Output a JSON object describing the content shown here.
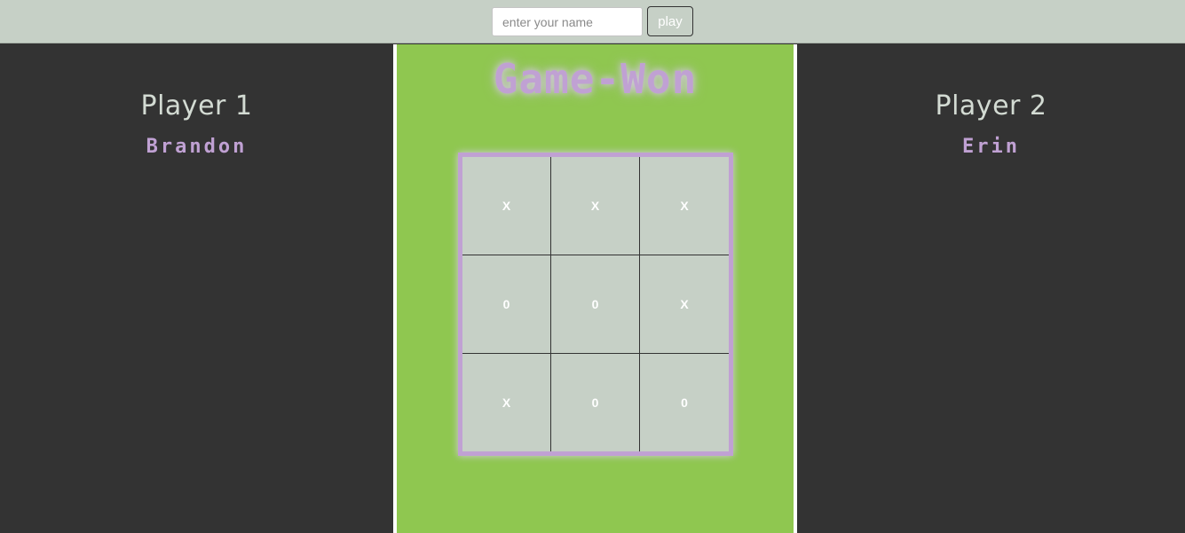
{
  "header": {
    "name_input": {
      "value": "",
      "placeholder": "enter your name"
    },
    "play_label": "play"
  },
  "player1": {
    "heading": "Player 1",
    "name": "Brandon"
  },
  "player2": {
    "heading": "Player 2",
    "name": "Erin"
  },
  "game": {
    "status": "Game-Won",
    "board": [
      [
        "X",
        "X",
        "X"
      ],
      [
        "0",
        "0",
        "X"
      ],
      [
        "X",
        "0",
        "0"
      ]
    ]
  },
  "colors": {
    "topbar": "#c6d0c6",
    "side_panel": "#333333",
    "center_panel": "#8fc750",
    "accent_purple": "#c0a1d3",
    "cell_background": "#c6d0c6"
  }
}
